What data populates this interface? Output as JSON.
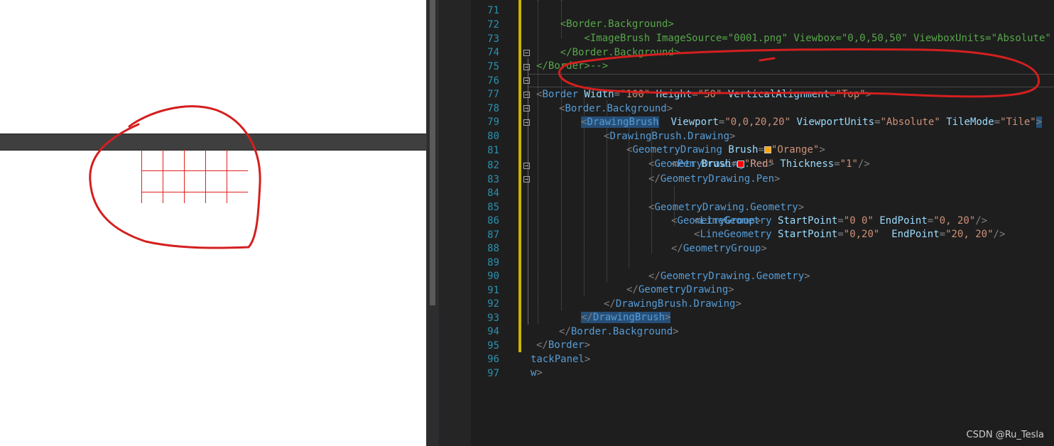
{
  "designer": {
    "tile_color": "#e02020"
  },
  "editor": {
    "lines": [
      {
        "num": "71",
        "code": "        <Border.Background>"
      },
      {
        "num": "72",
        "code": "            <ImageBrush ImageSource=\"0001.png\" Viewbox=\"0,0,50,50\" ViewboxUnits=\"Absolute\" />"
      },
      {
        "num": "73",
        "code": "        </Border.Background>"
      },
      {
        "num": "74",
        "code": "    </Border>-->"
      },
      {
        "num": "75",
        "code": "<Border Width=\"100\" Height=\"50\" VerticalAlignment=\"Top\">"
      },
      {
        "num": "76",
        "code": "    <Border.Background>"
      },
      {
        "num": "77",
        "code": "        <DrawingBrush  Viewport=\"0,0,20,20\" ViewportUnits=\"Absolute\" TileMode=\"Tile\">"
      },
      {
        "num": "78",
        "code": "            <DrawingBrush.Drawing>"
      },
      {
        "num": "79",
        "code": "                <GeometryDrawing Brush=■\"Orange\">"
      },
      {
        "num": "80",
        "code": "                    <GeometryDrawing.Pen>"
      },
      {
        "num": "81",
        "code": "                        <Pen Brush=■\"Red\" Thickness=\"1\"/>"
      },
      {
        "num": "82",
        "code": "                    </GeometryDrawing.Pen>"
      },
      {
        "num": "83",
        "code": "                    <GeometryDrawing.Geometry>"
      },
      {
        "num": "84",
        "code": "                        <GeometryGroup>"
      },
      {
        "num": "85",
        "code": "                            <LineGeometry StartPoint=\"0 0\" EndPoint=\"0, 20\"/>"
      },
      {
        "num": "86",
        "code": "                            <LineGeometry StartPoint=\"0,20\"  EndPoint=\"20, 20\"/>"
      },
      {
        "num": "87",
        "code": "                        </GeometryGroup>"
      },
      {
        "num": "88",
        "code": ""
      },
      {
        "num": "89",
        "code": "                    </GeometryDrawing.Geometry>"
      },
      {
        "num": "90",
        "code": "                </GeometryDrawing>"
      },
      {
        "num": "91",
        "code": "            </DrawingBrush.Drawing>"
      },
      {
        "num": "92",
        "code": "        </DrawingBrush>"
      },
      {
        "num": "93",
        "code": "    </Border.Background>"
      },
      {
        "num": "94",
        "code": "</Border>"
      },
      {
        "num": "95",
        "code": "tackPanel>"
      },
      {
        "num": "96",
        "code": "w>"
      },
      {
        "num": "97",
        "code": ""
      }
    ]
  },
  "colors": {
    "orange_swatch": "#ffa500",
    "red_swatch": "#ff0000",
    "annotation": "#d41f1f"
  },
  "watermark": "CSDN @Ru_Tesla"
}
